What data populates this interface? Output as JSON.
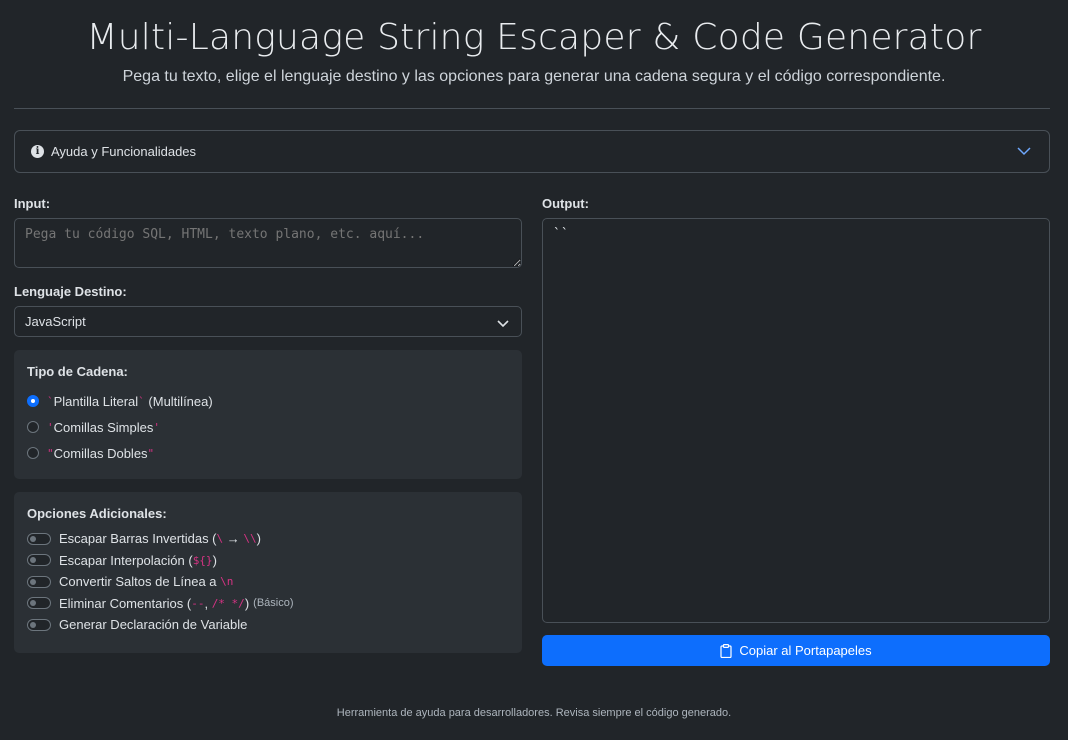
{
  "header": {
    "title": "Multi-Language String Escaper & Code Generator",
    "subtitle": "Pega tu texto, elige el lenguaje destino y las opciones para generar una cadena segura y el código correspondiente."
  },
  "accordion": {
    "label": "Ayuda y Funcionalidades",
    "icon": "info-icon",
    "expanded": false
  },
  "input": {
    "label": "Input:",
    "value": "",
    "placeholder": "Pega tu código SQL, HTML, texto plano, etc. aquí..."
  },
  "language": {
    "label": "Lenguaje Destino:",
    "selected": "JavaScript"
  },
  "string_type": {
    "title": "Tipo de Cadena:",
    "options": [
      {
        "code_open": "`",
        "label": "Plantilla Literal",
        "code_close": "`",
        "suffix": " (Multilínea)",
        "checked": true
      },
      {
        "code_open": "'",
        "label": "Comillas Simples",
        "code_close": "'",
        "suffix": "",
        "checked": false
      },
      {
        "code_open": "\"",
        "label": "Comillas Dobles",
        "code_close": "\"",
        "suffix": "",
        "checked": false
      }
    ]
  },
  "options": {
    "title": "Opciones Adicionales:",
    "items": [
      {
        "prefix": "Escapar Barras Invertidas (",
        "code1": "\\",
        "mid": " → ",
        "code2": "\\\\",
        "suffix": ")",
        "small": "",
        "enabled": false
      },
      {
        "prefix": "Escapar Interpolación (",
        "code1": "${}",
        "mid": "",
        "code2": "",
        "suffix": ")",
        "small": "",
        "enabled": false
      },
      {
        "prefix": "Convertir Saltos de Línea a ",
        "code1": "\\n",
        "mid": "",
        "code2": "",
        "suffix": "",
        "small": "",
        "enabled": false
      },
      {
        "prefix": "Eliminar Comentarios (",
        "code1": "--",
        "mid": ", ",
        "code2": "/* */",
        "suffix": ")",
        "small": "(Básico)",
        "enabled": false
      },
      {
        "prefix": "Generar Declaración de Variable",
        "code1": "",
        "mid": "",
        "code2": "",
        "suffix": "",
        "small": "",
        "enabled": false
      }
    ]
  },
  "output": {
    "label": "Output:",
    "value": "``"
  },
  "copy_button": {
    "label": "Copiar al Portapapeles",
    "icon": "clipboard-icon"
  },
  "footer": {
    "text": "Herramienta de ayuda para desarrolladores. Revisa siempre el código generado."
  },
  "colors": {
    "background": "#212529",
    "accent": "#0d6efd",
    "code": "#d63384",
    "panel": "#2b3035"
  }
}
